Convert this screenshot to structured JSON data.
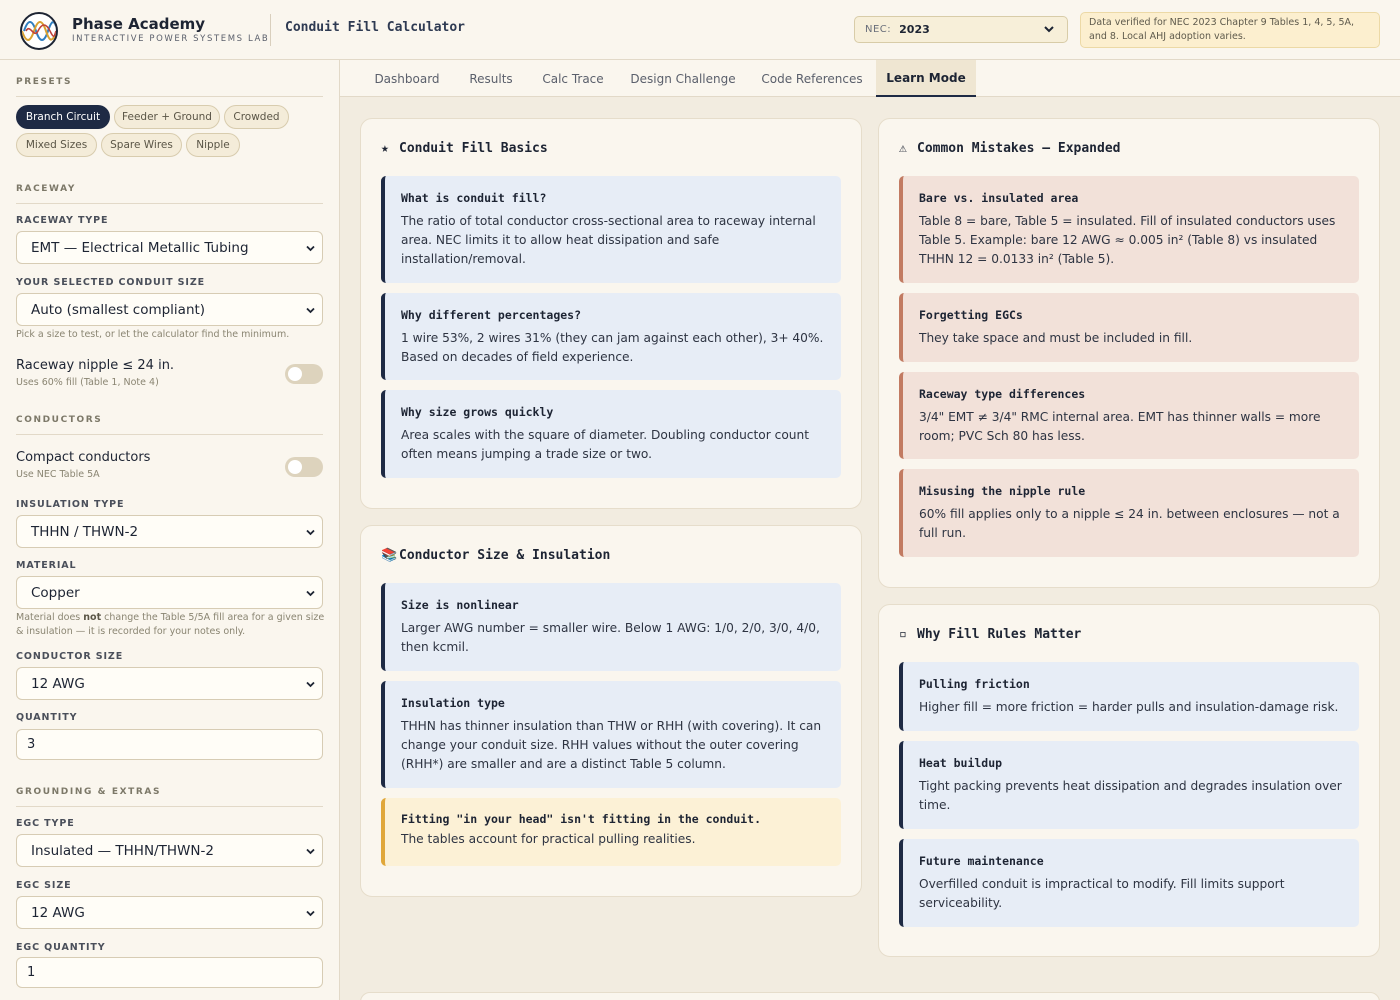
{
  "header": {
    "brand_name": "Phase Academy",
    "brand_sub": "INTERACTIVE POWER SYSTEMS LAB",
    "app_title": "Conduit Fill Calculator",
    "nec_label": "NEC:",
    "nec_value": "2023",
    "notice": "Data verified for NEC 2023 Chapter 9 Tables 1, 4, 5, 5A, and 8. Local AHJ adoption varies."
  },
  "sidebar": {
    "presets_title": "PRESETS",
    "presets": [
      "Branch Circuit",
      "Feeder + Ground",
      "Crowded",
      "Mixed Sizes",
      "Spare Wires",
      "Nipple"
    ],
    "active_preset": "Branch Circuit",
    "raceway_title": "RACEWAY",
    "raceway_type_label": "RACEWAY TYPE",
    "raceway_type_value": "EMT — Electrical Metallic Tubing",
    "conduit_size_label": "YOUR SELECTED CONDUIT SIZE",
    "conduit_size_value": "Auto (smallest compliant)",
    "conduit_size_hint": "Pick a size to test, or let the calculator find the minimum.",
    "nipple_label": "Raceway nipple ≤ 24 in.",
    "nipple_sub": "Uses 60% fill (Table 1, Note 4)",
    "nipple_on": false,
    "conductors_title": "CONDUCTORS",
    "compact_label": "Compact conductors",
    "compact_sub": "Use NEC Table 5A",
    "compact_on": false,
    "insulation_label": "INSULATION TYPE",
    "insulation_value": "THHN / THWN-2",
    "material_label": "MATERIAL",
    "material_value": "Copper",
    "material_hint_1": "Material does",
    "material_hint_bold": "not",
    "material_hint_2": "change the Table 5/5A fill area for a given size & insulation — it is recorded for your notes only.",
    "conductor_size_label": "CONDUCTOR SIZE",
    "conductor_size_value": "12 AWG",
    "quantity_label": "QUANTITY",
    "quantity_value": "3",
    "grounding_title": "GROUNDING & EXTRAS",
    "egc_type_label": "EGC TYPE",
    "egc_type_value": "Insulated — THHN/THWN-2",
    "egc_size_label": "EGC SIZE",
    "egc_size_value": "12 AWG",
    "egc_qty_label": "EGC QUANTITY",
    "egc_qty_value": "1"
  },
  "tabs": [
    "Dashboard",
    "Results",
    "Calc Trace",
    "Design Challenge",
    "Code References",
    "Learn Mode"
  ],
  "active_tab": "Learn Mode",
  "cards": {
    "basics": {
      "icon": "★",
      "title": "Conduit Fill Basics",
      "notes": [
        {
          "head": "What is conduit fill?",
          "body": "The ratio of total conductor cross-sectional area to raceway internal area. NEC limits it to allow heat dissipation and safe installation/removal."
        },
        {
          "head": "Why different percentages?",
          "body": "1 wire 53%, 2 wires 31% (they can jam against each other), 3+ 40%. Based on decades of field experience."
        },
        {
          "head": "Why size grows quickly",
          "body": "Area scales with the square of diameter. Doubling conductor count often means jumping a trade size or two."
        }
      ]
    },
    "sizes": {
      "icon": "📚",
      "title": "Conductor Size & Insulation",
      "notes": [
        {
          "head": "Size is nonlinear",
          "body": "Larger AWG number = smaller wire. Below 1 AWG: 1/0, 2/0, 3/0, 4/0, then kcmil."
        },
        {
          "head": "Insulation type",
          "body": "THHN has thinner insulation than THW or RHH (with covering). It can change your conduit size. RHH values without the outer covering (RHH*) are smaller and are a distinct Table 5 column."
        },
        {
          "head": "Fitting \"in your head\" isn't fitting in the conduit.",
          "body": "The tables account for practical pulling realities."
        }
      ]
    },
    "mistakes": {
      "icon": "⚠",
      "title": "Common Mistakes — Expanded",
      "notes": [
        {
          "head": "Bare vs. insulated area",
          "body": "Table 8 = bare, Table 5 = insulated. Fill of insulated conductors uses Table 5. Example: bare 12 AWG ≈ 0.005 in² (Table 8) vs insulated THHN 12 = 0.0133 in² (Table 5)."
        },
        {
          "head": "Forgetting EGCs",
          "body": "They take space and must be included in fill."
        },
        {
          "head": "Raceway type differences",
          "body": "3/4\" EMT ≠ 3/4\" RMC internal area. EMT has thinner walls = more room; PVC Sch 80 has less."
        },
        {
          "head": "Misusing the nipple rule",
          "body": "60% fill applies only to a nipple ≤ 24 in. between enclosures — not a full run."
        }
      ]
    },
    "why": {
      "icon": "▫",
      "title": "Why Fill Rules Matter",
      "notes": [
        {
          "head": "Pulling friction",
          "body": "Higher fill = more friction = harder pulls and insulation-damage risk."
        },
        {
          "head": "Heat buildup",
          "body": "Tight packing prevents heat dissipation and degrades insulation over time."
        },
        {
          "head": "Future maintenance",
          "body": "Overfilled conduit is impractical to modify. Fill limits support serviceability."
        }
      ]
    }
  },
  "colors": {
    "navy": "#1e2a44",
    "background": "#f2ece0",
    "panel": "#faf6ee",
    "note_blue": "#e7edf6",
    "note_warm": "#f2e1d9",
    "note_yellow": "#fcf1d6"
  }
}
